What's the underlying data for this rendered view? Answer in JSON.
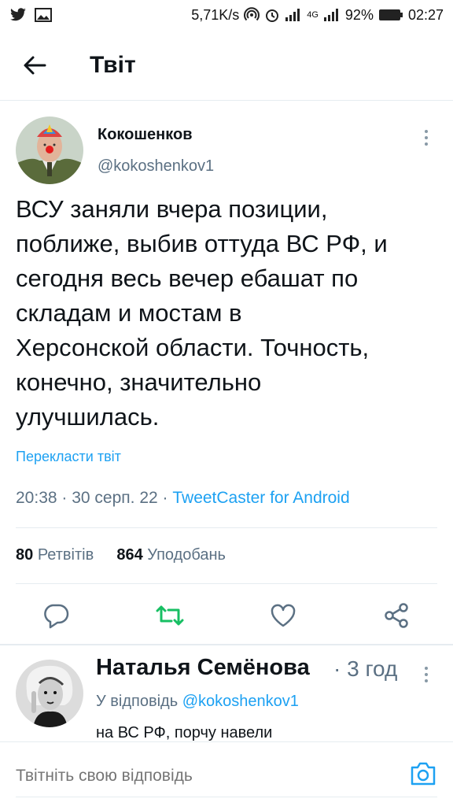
{
  "status_bar": {
    "network_speed": "5,71K/s",
    "network_type": "4G",
    "battery": "92%",
    "time": "02:27"
  },
  "header": {
    "title": "Твіт"
  },
  "tweet": {
    "author_name": "Кокошенков",
    "author_handle": "@kokoshenkov1",
    "text": "ВСУ заняли вчера позиции,\nпоближе, выбив оттуда ВС РФ, и\nсегодня весь вечер ебашат по\nскладам и мостам в\nХерсонской области. Точность,\nконечно, значительно\nулучшилась.",
    "translate_label": "Перекласти твіт",
    "time": "20:38",
    "date": "30 серп. 22",
    "source": "TweetCaster for Android",
    "retweets_count": "80",
    "retweets_label": "Ретвітів",
    "likes_count": "864",
    "likes_label": "Уподобань"
  },
  "reply": {
    "author_name": "Наталья Семёнова",
    "time": "3 год",
    "reply_to_label": "У відповідь",
    "reply_to_handle": "@kokoshenkov1",
    "text": "на ВС РФ, порчу навели"
  },
  "compose": {
    "placeholder": "Твітніть свою відповідь"
  },
  "colors": {
    "accent": "#1da1f2",
    "retweet_green": "#17bf63",
    "secondary_text": "#5b7083"
  }
}
